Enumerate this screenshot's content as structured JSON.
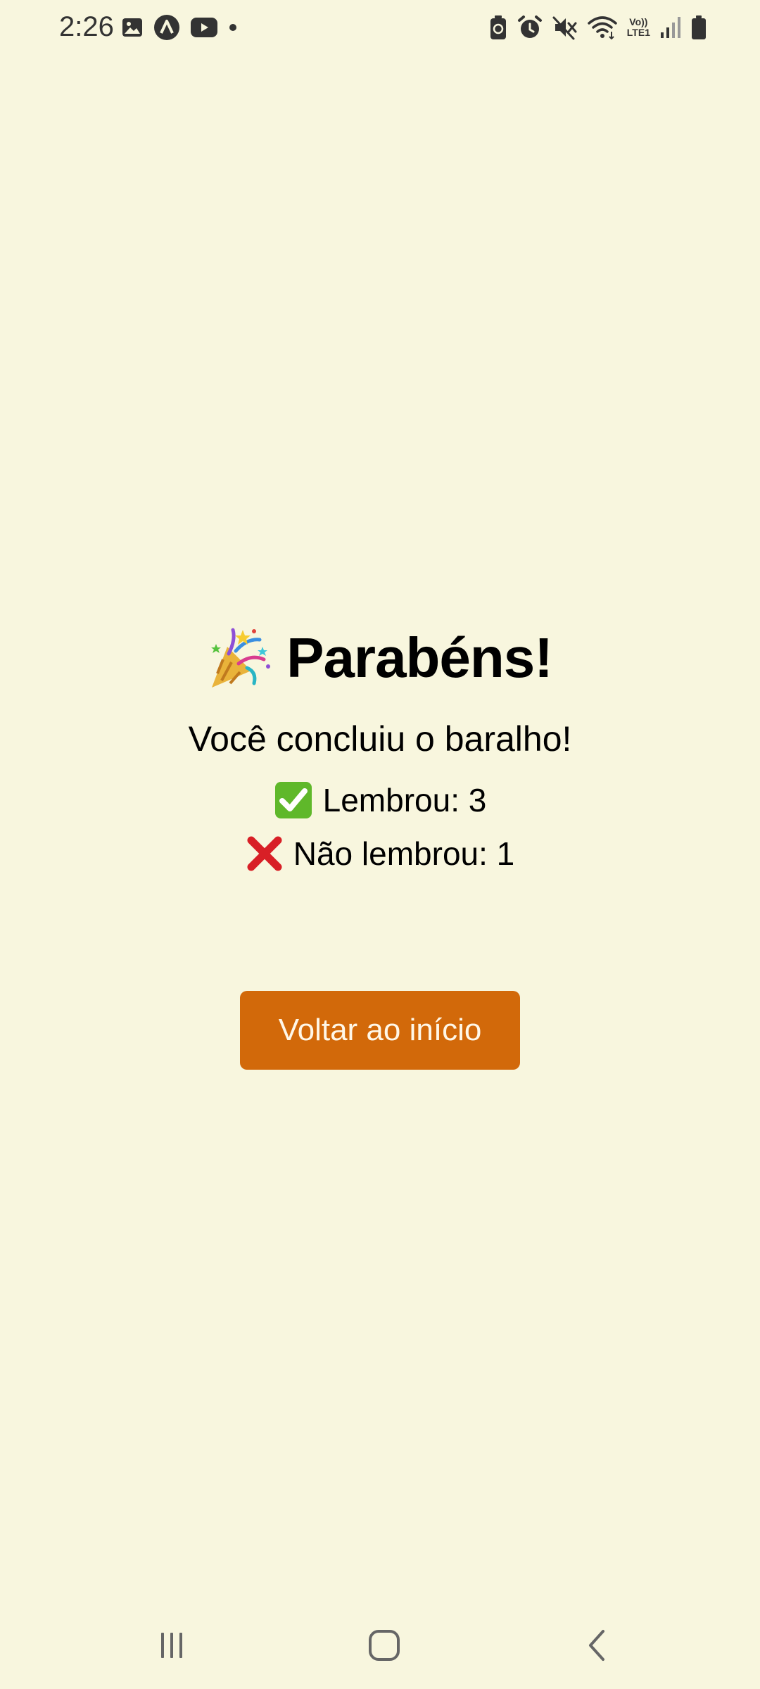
{
  "status_bar": {
    "time": "2:26",
    "left_icons": [
      "image-icon",
      "app-a-icon",
      "youtube-icon",
      "notification-dot-icon"
    ],
    "right_icons": [
      "battery-saver-icon",
      "alarm-icon",
      "mute-icon",
      "wifi-icon",
      "volte-icon",
      "signal-icon",
      "battery-icon"
    ],
    "volte_line1": "Vo))",
    "volte_line2": "LTE1"
  },
  "main": {
    "title_icon": "party-popper-icon",
    "title": "Parabéns!",
    "subtitle": "Você concluiu o baralho!",
    "remembered": {
      "icon": "check-mark-icon",
      "text": "Lembrou: 3"
    },
    "forgot": {
      "icon": "cross-mark-icon",
      "text": "Não lembrou: 1"
    },
    "back_button_label": "Voltar ao início"
  },
  "nav_bar": {
    "buttons": [
      "recents-icon",
      "home-icon",
      "back-icon"
    ]
  },
  "colors": {
    "background": "#f8f6de",
    "button": "#d2690a",
    "button_text": "#fff7e8",
    "check_green": "#5fb82a",
    "cross_red": "#d81f26"
  }
}
